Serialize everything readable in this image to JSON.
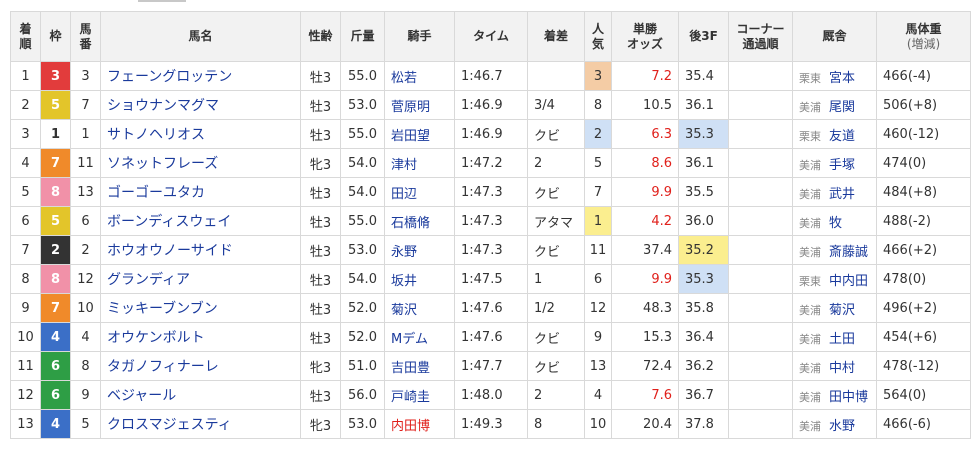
{
  "headers": {
    "rank": [
      "着",
      "順"
    ],
    "waku": "枠",
    "umaban": [
      "馬",
      "番"
    ],
    "horse": "馬名",
    "sexage": "性齢",
    "weight": "斤量",
    "jockey": "騎手",
    "time": "タイム",
    "margin": "着差",
    "popularity": [
      "人",
      "気"
    ],
    "odds": [
      "単勝",
      "オッズ"
    ],
    "last3f": "後3F",
    "corner": [
      "コーナー",
      "通過順"
    ],
    "stable": "厩舎",
    "bodyweight": [
      "馬体重",
      "(増減)"
    ]
  },
  "colors": {
    "waku1": "#ffffff",
    "waku2": "#333333",
    "waku3": "#e23c3c",
    "waku4": "#3b6fc7",
    "waku5": "#e3c52a",
    "waku6": "#2e9e45",
    "waku7": "#f08a2a",
    "waku8": "#f191a8",
    "pop1": "#fbee8f",
    "pop2": "#cfe0f5",
    "pop3": "#f4cca5",
    "hot_odds": "#e0201b",
    "link": "#1a3a9c"
  },
  "rows": [
    {
      "rank": "1",
      "waku": "3",
      "umaban": "3",
      "horse": "フェーングロッテン",
      "sexage": "牡3",
      "weight": "55.0",
      "jockey": "松若",
      "time": "1:46.7",
      "margin": "",
      "popularity": "3",
      "odds": "7.2",
      "last3f": "35.4",
      "corner": "",
      "region": "栗東",
      "trainer": "宮本",
      "bodyweight": "466(-4)"
    },
    {
      "rank": "2",
      "waku": "5",
      "umaban": "7",
      "horse": "ショウナンマグマ",
      "sexage": "牡3",
      "weight": "53.0",
      "jockey": "菅原明",
      "time": "1:46.9",
      "margin": "3/4",
      "popularity": "8",
      "odds": "10.5",
      "last3f": "36.1",
      "corner": "",
      "region": "美浦",
      "trainer": "尾関",
      "bodyweight": "506(+8)"
    },
    {
      "rank": "3",
      "waku": "1",
      "umaban": "1",
      "horse": "サトノヘリオス",
      "sexage": "牡3",
      "weight": "55.0",
      "jockey": "岩田望",
      "time": "1:46.9",
      "margin": "クビ",
      "popularity": "2",
      "odds": "6.3",
      "last3f": "35.3",
      "corner": "",
      "region": "栗東",
      "trainer": "友道",
      "bodyweight": "460(-12)"
    },
    {
      "rank": "4",
      "waku": "7",
      "umaban": "11",
      "horse": "ソネットフレーズ",
      "sexage": "牝3",
      "weight": "54.0",
      "jockey": "津村",
      "time": "1:47.2",
      "margin": "2",
      "popularity": "5",
      "odds": "8.6",
      "last3f": "36.1",
      "corner": "",
      "region": "美浦",
      "trainer": "手塚",
      "bodyweight": "474(0)"
    },
    {
      "rank": "5",
      "waku": "8",
      "umaban": "13",
      "horse": "ゴーゴーユタカ",
      "sexage": "牡3",
      "weight": "54.0",
      "jockey": "田辺",
      "time": "1:47.3",
      "margin": "クビ",
      "popularity": "7",
      "odds": "9.9",
      "last3f": "35.5",
      "corner": "",
      "region": "美浦",
      "trainer": "武井",
      "bodyweight": "484(+8)"
    },
    {
      "rank": "6",
      "waku": "5",
      "umaban": "6",
      "horse": "ボーンディスウェイ",
      "sexage": "牡3",
      "weight": "55.0",
      "jockey": "石橋脩",
      "time": "1:47.3",
      "margin": "アタマ",
      "popularity": "1",
      "odds": "4.2",
      "last3f": "36.0",
      "corner": "",
      "region": "美浦",
      "trainer": "牧",
      "bodyweight": "488(-2)"
    },
    {
      "rank": "7",
      "waku": "2",
      "umaban": "2",
      "horse": "ホウオウノーサイド",
      "sexage": "牡3",
      "weight": "53.0",
      "jockey": "永野",
      "time": "1:47.3",
      "margin": "クビ",
      "popularity": "11",
      "odds": "37.4",
      "last3f": "35.2",
      "corner": "",
      "region": "美浦",
      "trainer": "斎藤誠",
      "bodyweight": "466(+2)"
    },
    {
      "rank": "8",
      "waku": "8",
      "umaban": "12",
      "horse": "グランディア",
      "sexage": "牡3",
      "weight": "54.0",
      "jockey": "坂井",
      "time": "1:47.5",
      "margin": "1",
      "popularity": "6",
      "odds": "9.9",
      "last3f": "35.3",
      "corner": "",
      "region": "栗東",
      "trainer": "中内田",
      "bodyweight": "478(0)"
    },
    {
      "rank": "9",
      "waku": "7",
      "umaban": "10",
      "horse": "ミッキーブンブン",
      "sexage": "牡3",
      "weight": "52.0",
      "jockey": "菊沢",
      "time": "1:47.6",
      "margin": "1/2",
      "popularity": "12",
      "odds": "48.3",
      "last3f": "35.8",
      "corner": "",
      "region": "美浦",
      "trainer": "菊沢",
      "bodyweight": "496(+2)"
    },
    {
      "rank": "10",
      "waku": "4",
      "umaban": "4",
      "horse": "オウケンボルト",
      "sexage": "牡3",
      "weight": "52.0",
      "jockey": "Mデム",
      "time": "1:47.6",
      "margin": "クビ",
      "popularity": "9",
      "odds": "15.3",
      "last3f": "36.4",
      "corner": "",
      "region": "美浦",
      "trainer": "土田",
      "bodyweight": "454(+6)"
    },
    {
      "rank": "11",
      "waku": "6",
      "umaban": "8",
      "horse": "タガノフィナーレ",
      "sexage": "牝3",
      "weight": "51.0",
      "jockey": "吉田豊",
      "time": "1:47.7",
      "margin": "クビ",
      "popularity": "13",
      "odds": "72.4",
      "last3f": "36.2",
      "corner": "",
      "region": "美浦",
      "trainer": "中村",
      "bodyweight": "478(-12)"
    },
    {
      "rank": "12",
      "waku": "6",
      "umaban": "9",
      "horse": "ベジャール",
      "sexage": "牡3",
      "weight": "56.0",
      "jockey": "戸崎圭",
      "time": "1:48.0",
      "margin": "2",
      "popularity": "4",
      "odds": "7.6",
      "last3f": "36.7",
      "corner": "",
      "region": "美浦",
      "trainer": "田中博",
      "bodyweight": "564(0)"
    },
    {
      "rank": "13",
      "waku": "4",
      "umaban": "5",
      "horse": "クロスマジェスティ",
      "sexage": "牝3",
      "weight": "53.0",
      "jockey": "内田博",
      "time": "1:49.3",
      "margin": "8",
      "popularity": "10",
      "odds": "20.4",
      "last3f": "37.8",
      "corner": "",
      "region": "美浦",
      "trainer": "水野",
      "bodyweight": "466(-6)"
    }
  ]
}
